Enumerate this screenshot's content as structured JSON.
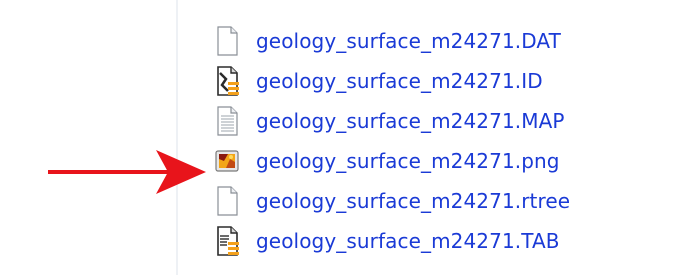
{
  "files": [
    {
      "name": "geology_surface_m24271.DAT",
      "icon": "blank-file-icon"
    },
    {
      "name": "geology_surface_m24271.ID",
      "icon": "mapinfo-id-file-icon"
    },
    {
      "name": "geology_surface_m24271.MAP",
      "icon": "text-file-icon"
    },
    {
      "name": "geology_surface_m24271.png",
      "icon": "image-file-icon"
    },
    {
      "name": "geology_surface_m24271.rtree",
      "icon": "blank-file-icon"
    },
    {
      "name": "geology_surface_m24271.TAB",
      "icon": "mapinfo-table-file-icon"
    }
  ],
  "colors": {
    "link_text": "#1a3ad6",
    "arrow": "#e8141b",
    "divider": "#eef1f5"
  },
  "annotation": {
    "arrow_target": "geology_surface_m24271.png",
    "icon": "red-arrow-icon"
  }
}
